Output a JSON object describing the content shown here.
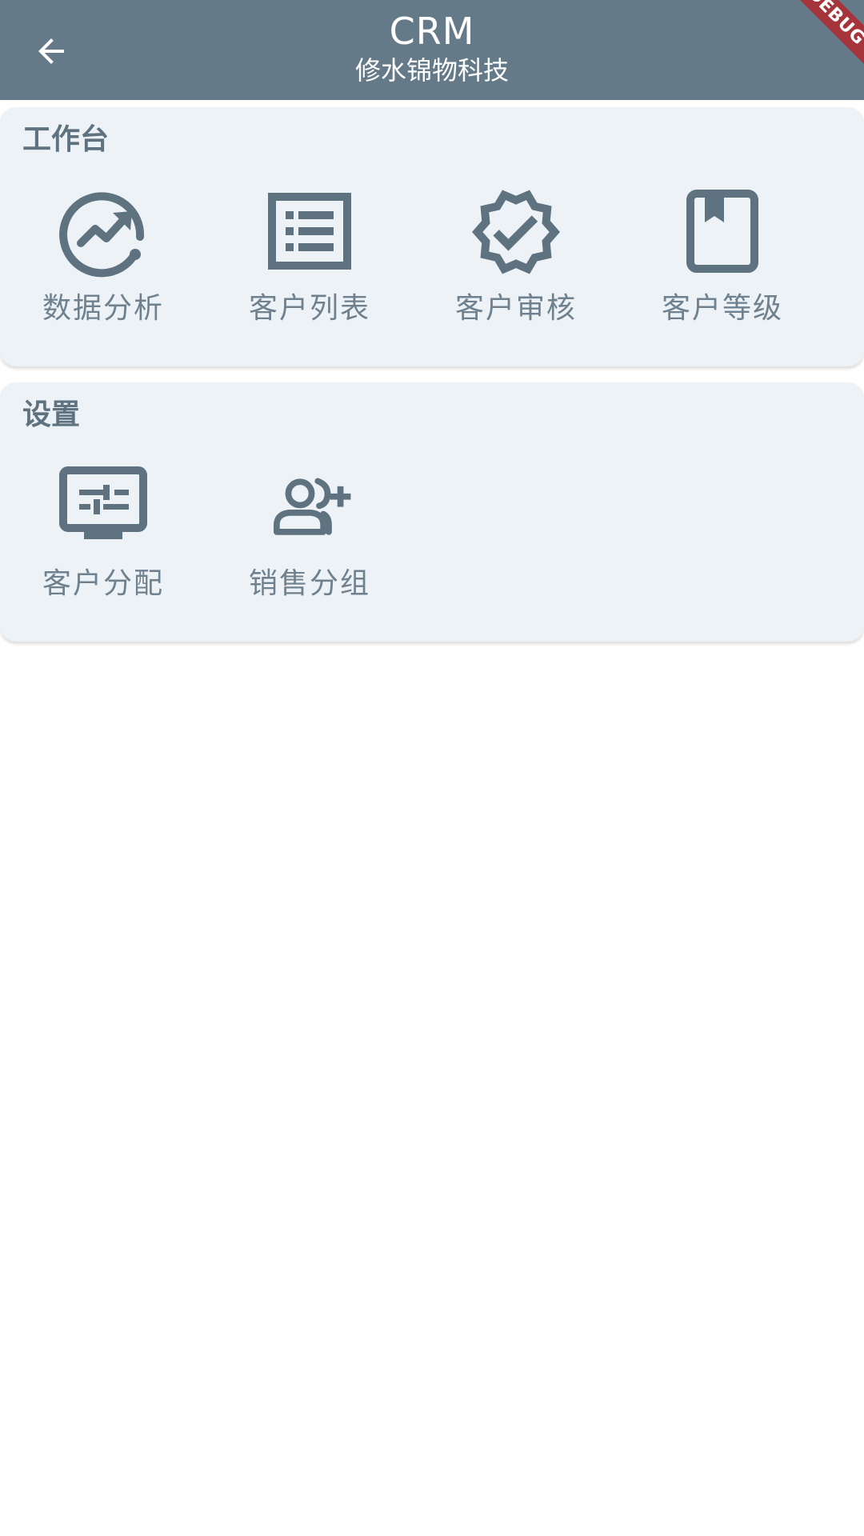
{
  "app_bar": {
    "title": "CRM",
    "subtitle": "修水锦物科技",
    "back_icon": "arrow-back-icon",
    "debug_banner": "DEBUG",
    "background_color": "#647a89"
  },
  "sections": [
    {
      "title": "工作台",
      "items": [
        {
          "label": "数据分析",
          "icon": "analytics-icon"
        },
        {
          "label": "客户列表",
          "icon": "list-icon"
        },
        {
          "label": "客户审核",
          "icon": "verified-badge-icon"
        },
        {
          "label": "客户等级",
          "icon": "bookmark-book-icon"
        }
      ]
    },
    {
      "title": "设置",
      "items": [
        {
          "label": "客户分配",
          "icon": "settings-display-icon"
        },
        {
          "label": "销售分组",
          "icon": "group-add-icon"
        }
      ]
    }
  ],
  "colors": {
    "card_background": "#edf2f6",
    "icon": "#5e7280",
    "label": "#6f818e"
  }
}
